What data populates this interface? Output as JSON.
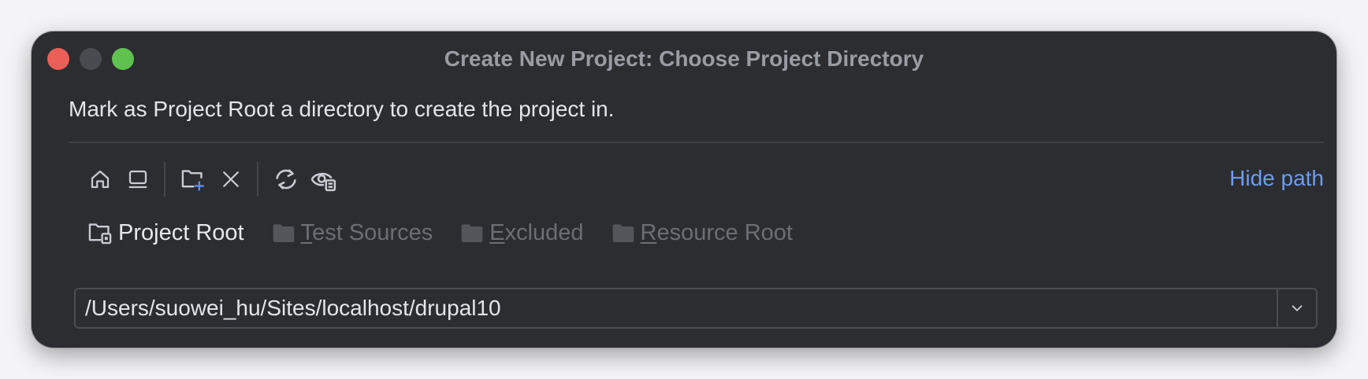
{
  "window": {
    "title": "Create New Project: Choose Project Directory",
    "traffic_lights": {
      "close_color": "#ec5f58",
      "minimize_color": "#4a4b50",
      "zoom_color": "#5fc24f"
    }
  },
  "description": "Mark as Project Root a directory to create the project in.",
  "toolbar": {
    "buttons": [
      {
        "icon": "home-icon"
      },
      {
        "icon": "desktop-icon"
      },
      {
        "icon": "new-folder-icon"
      },
      {
        "icon": "delete-icon"
      },
      {
        "icon": "refresh-icon"
      },
      {
        "icon": "show-hidden-icon"
      }
    ],
    "hide_path_label": "Hide path"
  },
  "root_types": [
    {
      "pre": "Project Root",
      "mnemonic": "",
      "post": "",
      "state": "active"
    },
    {
      "pre": "",
      "mnemonic": "T",
      "post": "est Sources",
      "state": "disabled"
    },
    {
      "pre": "",
      "mnemonic": "E",
      "post": "xcluded",
      "state": "disabled"
    },
    {
      "pre": "",
      "mnemonic": "R",
      "post": "esource Root",
      "state": "disabled"
    }
  ],
  "path_field": {
    "value": "/Users/suowei_hu/Sites/localhost/drupal10"
  },
  "colors": {
    "window_bg": "#2b2d31",
    "accent_link": "#6d9bf0",
    "text_primary": "#e3e5ea",
    "text_disabled": "#6c6e74"
  }
}
